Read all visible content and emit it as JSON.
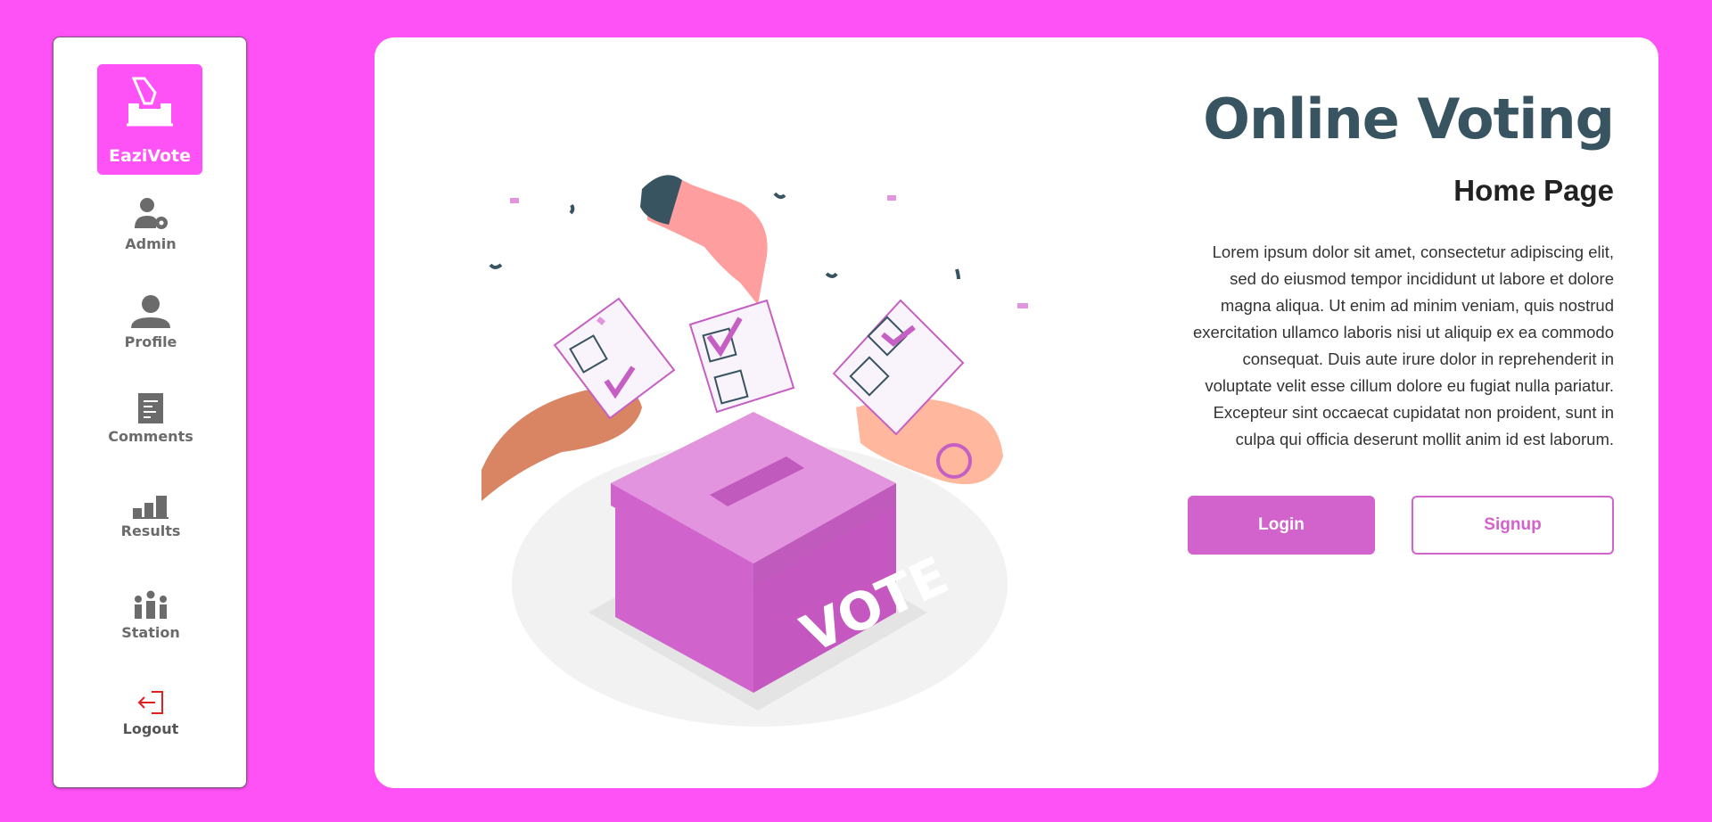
{
  "brand": {
    "name": "EaziVote",
    "icon": "ballot-box-icon"
  },
  "nav": {
    "admin": {
      "label": "Admin",
      "icon": "user-gear-icon"
    },
    "profile": {
      "label": "Profile",
      "icon": "user-icon"
    },
    "comments": {
      "label": "Comments",
      "icon": "document-icon"
    },
    "results": {
      "label": "Results",
      "icon": "bar-chart-icon"
    },
    "station": {
      "label": "Station",
      "icon": "people-group-icon"
    },
    "logout": {
      "label": "Logout",
      "icon": "logout-icon"
    }
  },
  "hero": {
    "title": "Online Voting",
    "subtitle": "Home Page",
    "body": "Lorem ipsum dolor sit amet, consectetur adipiscing elit, sed do eiusmod tempor incididunt ut labore et dolore magna aliqua. Ut enim ad minim veniam, quis nostrud exercitation ullamco laboris nisi ut aliquip ex ea commodo consequat. Duis aute irure dolor in reprehenderit in voluptate velit esse cillum dolore eu fugiat nulla pariatur. Excepteur sint occaecat cupidatat non proident, sunt in culpa qui officia deserunt mollit anim id est laborum.",
    "login_label": "Login",
    "signup_label": "Signup",
    "illustration_text": "VOTE"
  },
  "colors": {
    "background": "#ff52f6",
    "accent": "#d263cd",
    "title": "#385461",
    "logout": "#e02020"
  }
}
